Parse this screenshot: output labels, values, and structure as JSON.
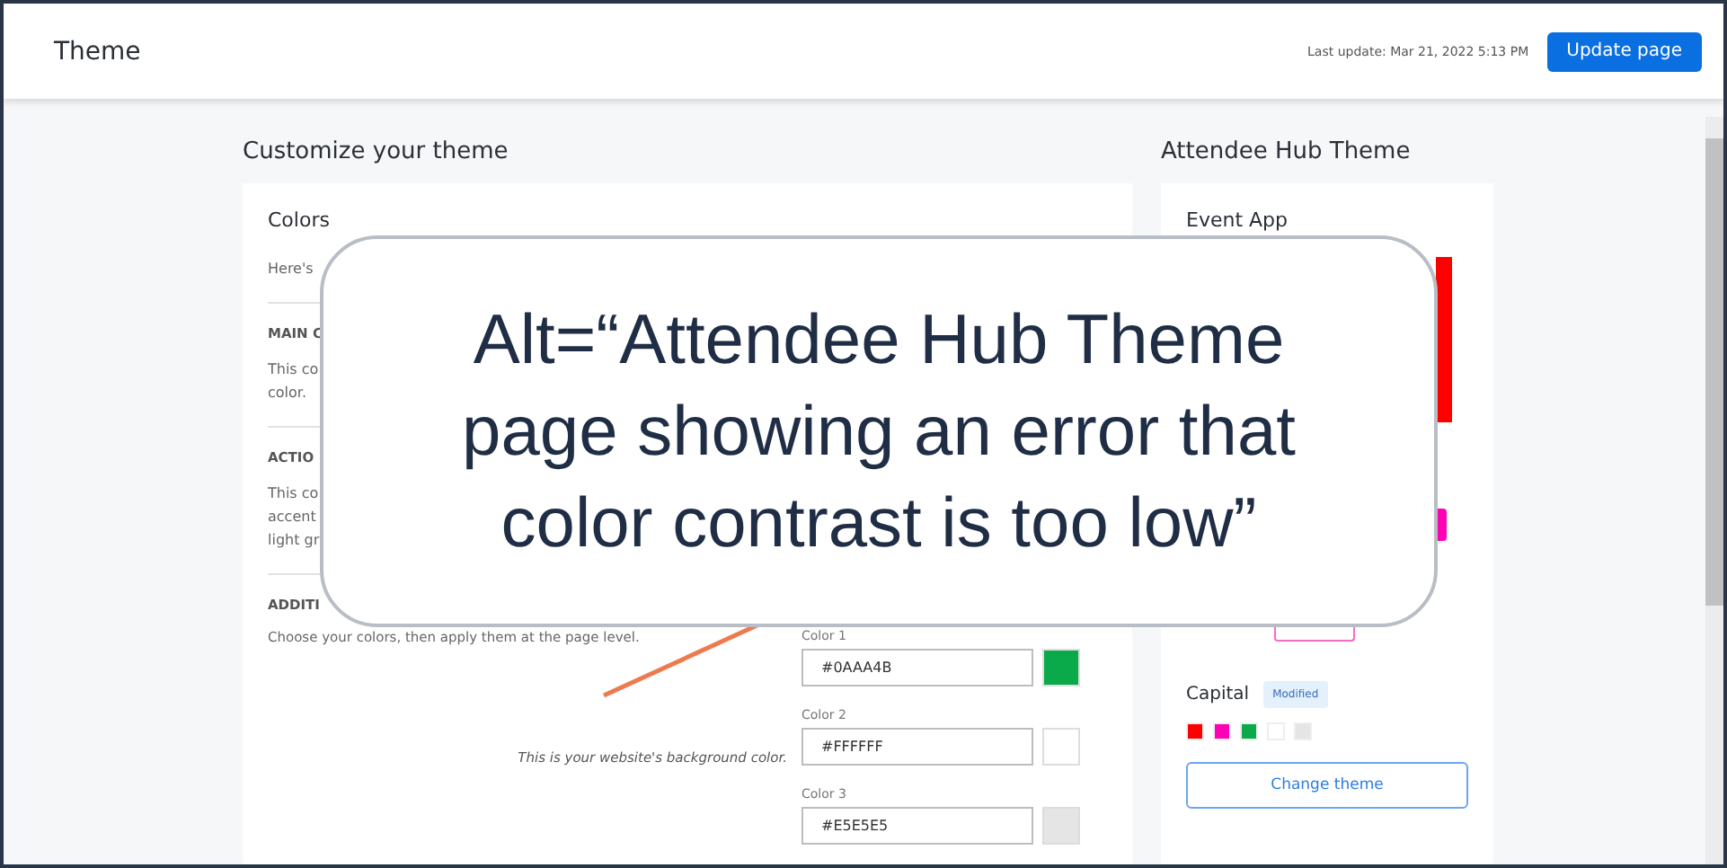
{
  "header": {
    "title": "Theme",
    "last_update": "Last update: Mar 21, 2022 5:13 PM",
    "update_button": "Update page"
  },
  "customize": {
    "heading": "Customize your theme",
    "card_title": "Colors",
    "intro": "Here's",
    "sections": [
      {
        "title": "MAIN C",
        "lines": [
          "This co",
          "color."
        ]
      },
      {
        "title": "ACTIO",
        "lines": [
          "This co",
          "accent",
          "light gr"
        ]
      },
      {
        "title": "ADDITI"
      }
    ],
    "description": "Choose your colors, then apply them at the page level.",
    "colors": [
      {
        "label": "Color 1",
        "value": "#0AAA4B",
        "color": "#0aaa4b"
      },
      {
        "label": "Color 2",
        "value": "#FFFFFF",
        "color": "#ffffff",
        "hint": "This is your website's background color."
      },
      {
        "label": "Color 3",
        "value": "#E5E5E5",
        "color": "#e5e5e5"
      }
    ]
  },
  "hub": {
    "heading": "Attendee Hub Theme",
    "card_title": "Event App",
    "theme_name": "Capital",
    "badge": "Modified",
    "swatches": [
      {
        "color": "#ff0000"
      },
      {
        "color": "#ff00b4"
      },
      {
        "color": "#0aaa4b"
      },
      {
        "color": "#ffffff"
      },
      {
        "color": "#e5e5e5"
      }
    ],
    "change_button": "Change theme"
  },
  "callout": {
    "text": "Alt=“Attendee Hub Theme page showing an error that color contrast is too low”"
  }
}
